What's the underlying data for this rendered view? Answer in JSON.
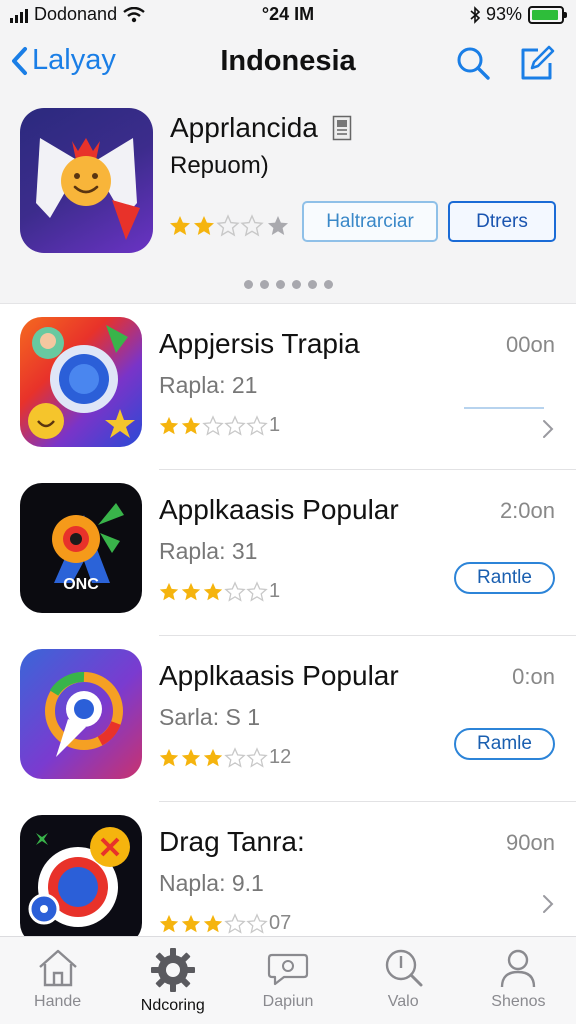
{
  "status_bar": {
    "carrier": "Dodonand",
    "time": "°24 IM",
    "battery": "93%",
    "battery_fill": 0.93
  },
  "nav": {
    "back_label": "Lalyay",
    "title": "Indonesia"
  },
  "featured": {
    "name": "Apprlancida",
    "subtitle": "Repuom)",
    "rating": 2,
    "button1_label": "Haltrarciar",
    "button2_label": "Dtrers"
  },
  "apps": [
    {
      "name": "Appjersis Trapia",
      "sub": "Rapla: 21",
      "rating": 2,
      "count": "1",
      "meta": "00on"
    },
    {
      "name": "Applkaasis Popular",
      "sub": "Rapla: 31",
      "rating": 3,
      "count": "1",
      "meta": "2:0on",
      "button": "Rantle"
    },
    {
      "name": "Applkaasis Popular",
      "sub": "Sarla: S 1",
      "rating": 3,
      "count": "12",
      "meta": "0:on",
      "button": "Ramle"
    },
    {
      "name": "Drag Tanra:",
      "sub": "Napla: 9.1",
      "rating": 3,
      "count": "07",
      "meta": "90on"
    }
  ],
  "icon2_text": "ONC",
  "tabs": [
    {
      "label": "Hande",
      "icon": "home-icon"
    },
    {
      "label": "Ndcoring",
      "icon": "gear-icon"
    },
    {
      "label": "Dapiun",
      "icon": "chat-icon"
    },
    {
      "label": "Valo",
      "icon": "search-icon"
    },
    {
      "label": "Shenos",
      "icon": "person-icon"
    }
  ],
  "colors": {
    "accent": "#1a7ee6",
    "star": "#f5b40e",
    "star_empty": "#c8c8c8"
  }
}
